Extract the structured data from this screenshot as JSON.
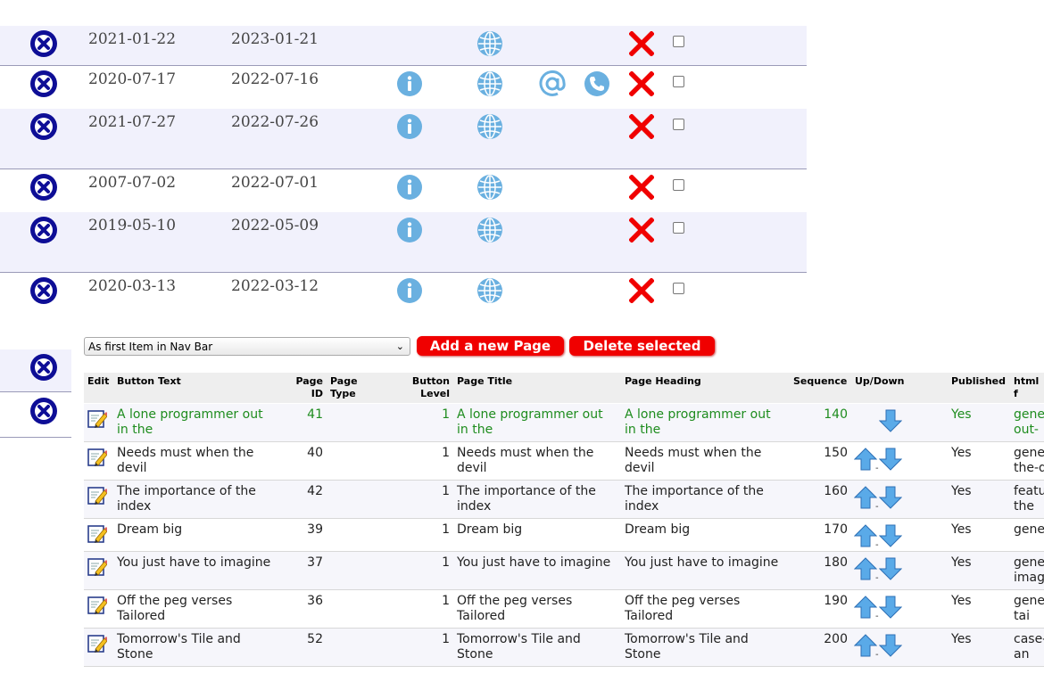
{
  "upper_rows": [
    {
      "start": "2021-01-22",
      "end": "2023-01-21",
      "info": false,
      "web": true,
      "email": false,
      "phone": false
    },
    {
      "start": "2020-07-17",
      "end": "2022-07-16",
      "info": true,
      "web": true,
      "email": true,
      "phone": true
    },
    {
      "start": "2021-07-27",
      "end": "2022-07-26",
      "info": true,
      "web": true,
      "email": false,
      "phone": false
    },
    {
      "start": "2007-07-02",
      "end": "2022-07-01",
      "info": true,
      "web": true,
      "email": false,
      "phone": false
    },
    {
      "start": "2019-05-10",
      "end": "2022-05-09",
      "info": true,
      "web": true,
      "email": false,
      "phone": false
    },
    {
      "start": "2020-03-13",
      "end": "2022-03-12",
      "info": true,
      "web": true,
      "email": false,
      "phone": false
    }
  ],
  "controls": {
    "position_select": "As first Item in Nav Bar",
    "add_button": "Add a new Page",
    "delete_button": "Delete selected"
  },
  "table": {
    "headers": {
      "edit": "Edit",
      "button_text": "Button Text",
      "page_id_1": "Page",
      "page_id_2": "ID",
      "page_type_1": "Page",
      "page_type_2": "Type",
      "button_level_1": "Button",
      "button_level_2": "Level",
      "page_title": "Page Title",
      "page_heading": "Page Heading",
      "sequence": "Sequence",
      "updown": "Up/Down",
      "published": "Published",
      "html": "html f"
    },
    "rows": [
      {
        "text1": "A lone programmer out",
        "text2": "in the",
        "id": "41",
        "level": "1",
        "title1": "A lone programmer out",
        "title2": "in the",
        "heading1": "A lone programmer out",
        "heading2": "in the",
        "seq": "140",
        "published": "Yes",
        "html1": "gene",
        "html2": "out-",
        "up": false
      },
      {
        "text1": "Needs must when the",
        "text2": "devil",
        "id": "40",
        "level": "1",
        "title1": "Needs must when the",
        "title2": "devil",
        "heading1": "Needs must when the",
        "heading2": "devil",
        "seq": "150",
        "published": "Yes",
        "html1": "gene",
        "html2": "the-d",
        "up": true
      },
      {
        "text1": "The importance of the",
        "text2": "index",
        "id": "42",
        "level": "1",
        "title1": "The importance of the",
        "title2": "index",
        "heading1": "The importance of the",
        "heading2": "index",
        "seq": "160",
        "published": "Yes",
        "html1": "featu",
        "html2": "the",
        "up": true
      },
      {
        "text1": "Dream big",
        "text2": "",
        "id": "39",
        "level": "1",
        "title1": "Dream big",
        "title2": "",
        "heading1": "Dream big",
        "heading2": "",
        "seq": "170",
        "published": "Yes",
        "html1": "gene",
        "html2": "",
        "up": true
      },
      {
        "text1": "You just have to imagine",
        "text2": "",
        "id": "37",
        "level": "1",
        "title1": "You just have to imagine",
        "title2": "",
        "heading1": "You just have to imagine",
        "heading2": "",
        "seq": "180",
        "published": "Yes",
        "html1": "gene",
        "html2": "imag",
        "up": true
      },
      {
        "text1": "Off the peg verses",
        "text2": "Tailored",
        "id": "36",
        "level": "1",
        "title1": "Off the peg verses",
        "title2": "Tailored",
        "heading1": "Off the peg verses",
        "heading2": "Tailored",
        "seq": "190",
        "published": "Yes",
        "html1": "gene",
        "html2": "tai",
        "up": true
      },
      {
        "text1": "Tomorrow's Tile and",
        "text2": "Stone",
        "id": "52",
        "level": "1",
        "title1": "Tomorrow's Tile and",
        "title2": "Stone",
        "heading1": "Tomorrow's Tile and",
        "heading2": "Stone",
        "seq": "200",
        "published": "Yes",
        "html1": "case-",
        "html2": "an",
        "up": true
      }
    ],
    "dash_text": "-"
  },
  "colors": {
    "accent_red": "#f00000",
    "icon_blue": "#6ab0e0",
    "dark_blue": "#0e0e96",
    "green_text": "#1e8c1e"
  }
}
